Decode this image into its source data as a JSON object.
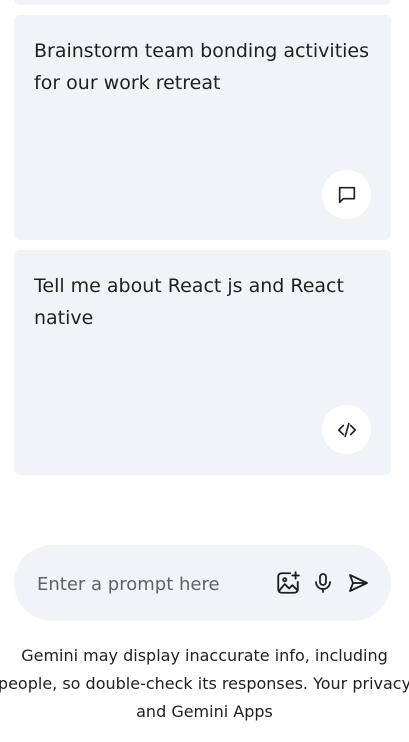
{
  "cards": [
    {
      "text": "Brainstorm team bonding activities for our work retreat",
      "icon": "chat-bubble-icon"
    },
    {
      "text": "Tell me about React js and React native",
      "icon": "code-icon"
    }
  ],
  "prompt": {
    "placeholder": "Enter a prompt here",
    "value": "",
    "icons": [
      "add-image-icon",
      "microphone-icon",
      "send-icon"
    ]
  },
  "disclaimer": "Gemini may display inaccurate info, including people, so double-check its responses. Your privacy and Gemini Apps"
}
